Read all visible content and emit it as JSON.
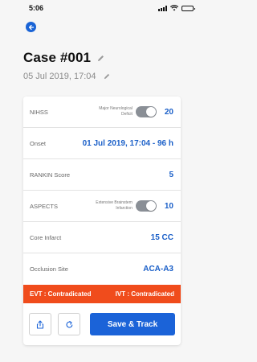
{
  "status_bar": {
    "time": "5:06"
  },
  "header": {
    "case_title": "Case #001",
    "case_date": "05 Jul 2019, 17:04"
  },
  "rows": [
    {
      "label": "NIHSS",
      "toggle_caption": "Major Neurological\nDeficit",
      "value": "20"
    },
    {
      "label": "Onset",
      "value": "01 Jul 2019, 17:04 - 96 h"
    },
    {
      "label": "RANKIN Score",
      "value": "5"
    },
    {
      "label": "ASPECTS",
      "toggle_caption": "Extensive Brainstem\nInfarction",
      "value": "10"
    },
    {
      "label": "Core Infarct",
      "value": "15 CC"
    },
    {
      "label": "Occlusion Site",
      "value": "ACA-A3"
    }
  ],
  "status_band": {
    "evt": "EVT : Contradicated",
    "ivt": "IVT : Contradicated",
    "color": "#f04c1c"
  },
  "actions": {
    "save_label": "Save & Track"
  },
  "colors": {
    "accent": "#1b63d8",
    "value_text": "#1a5fc8"
  },
  "icons": {
    "back": "arrow-left-circle",
    "edit": "pencil",
    "share": "share-upload",
    "reset": "refresh-arrow"
  }
}
